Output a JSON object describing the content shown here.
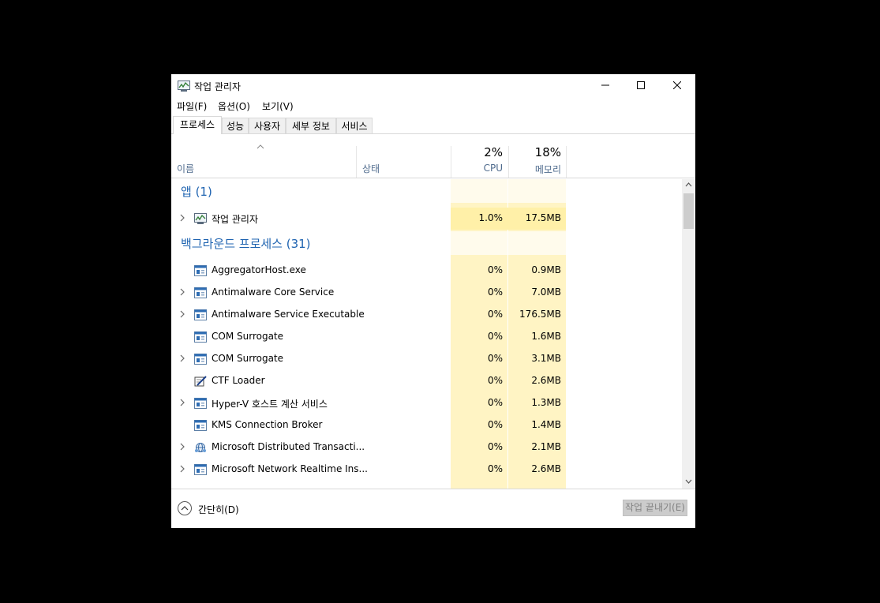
{
  "window": {
    "title": "작업 관리자"
  },
  "menu": [
    {
      "label": "파일(F)"
    },
    {
      "label": "옵션(O)"
    },
    {
      "label": "보기(V)"
    }
  ],
  "tabs": [
    {
      "label": "프로세스",
      "active": true
    },
    {
      "label": "성능"
    },
    {
      "label": "사용자"
    },
    {
      "label": "세부 정보"
    },
    {
      "label": "서비스"
    }
  ],
  "columns": {
    "name_label": "이름",
    "status_label": "상태",
    "cpu_percent": "2%",
    "cpu_label": "CPU",
    "mem_percent": "18%",
    "mem_label": "메모리"
  },
  "groups": {
    "apps": {
      "title": "앱 (1)",
      "rows": [
        {
          "name": "작업 관리자",
          "cpu": "1.0%",
          "mem": "17.5MB",
          "expandable": true,
          "icon": "task-manager-icon"
        }
      ]
    },
    "background": {
      "title": "백그라운드 프로세스 (31)",
      "rows": [
        {
          "name": "AggregatorHost.exe",
          "cpu": "0%",
          "mem": "0.9MB",
          "expandable": false,
          "icon": "process-window-icon"
        },
        {
          "name": "Antimalware Core Service",
          "cpu": "0%",
          "mem": "7.0MB",
          "expandable": true,
          "icon": "process-window-icon"
        },
        {
          "name": "Antimalware Service Executable",
          "cpu": "0%",
          "mem": "176.5MB",
          "expandable": true,
          "icon": "process-window-icon"
        },
        {
          "name": "COM Surrogate",
          "cpu": "0%",
          "mem": "1.6MB",
          "expandable": false,
          "icon": "process-window-icon"
        },
        {
          "name": "COM Surrogate",
          "cpu": "0%",
          "mem": "3.1MB",
          "expandable": true,
          "icon": "process-window-icon"
        },
        {
          "name": "CTF Loader",
          "cpu": "0%",
          "mem": "2.6MB",
          "expandable": false,
          "icon": "pen-paper-icon"
        },
        {
          "name": "Hyper-V 호스트 계산 서비스",
          "cpu": "0%",
          "mem": "1.3MB",
          "expandable": true,
          "icon": "process-window-icon"
        },
        {
          "name": "KMS Connection Broker",
          "cpu": "0%",
          "mem": "1.4MB",
          "expandable": false,
          "icon": "process-window-icon"
        },
        {
          "name": "Microsoft Distributed Transacti...",
          "cpu": "0%",
          "mem": "2.1MB",
          "expandable": true,
          "icon": "network-globe-icon"
        },
        {
          "name": "Microsoft Network Realtime Ins...",
          "cpu": "0%",
          "mem": "2.6MB",
          "expandable": true,
          "icon": "process-window-icon"
        }
      ]
    }
  },
  "footer": {
    "fewer_details": "간단히(D)",
    "end_task": "작업 끝내기(E)"
  }
}
